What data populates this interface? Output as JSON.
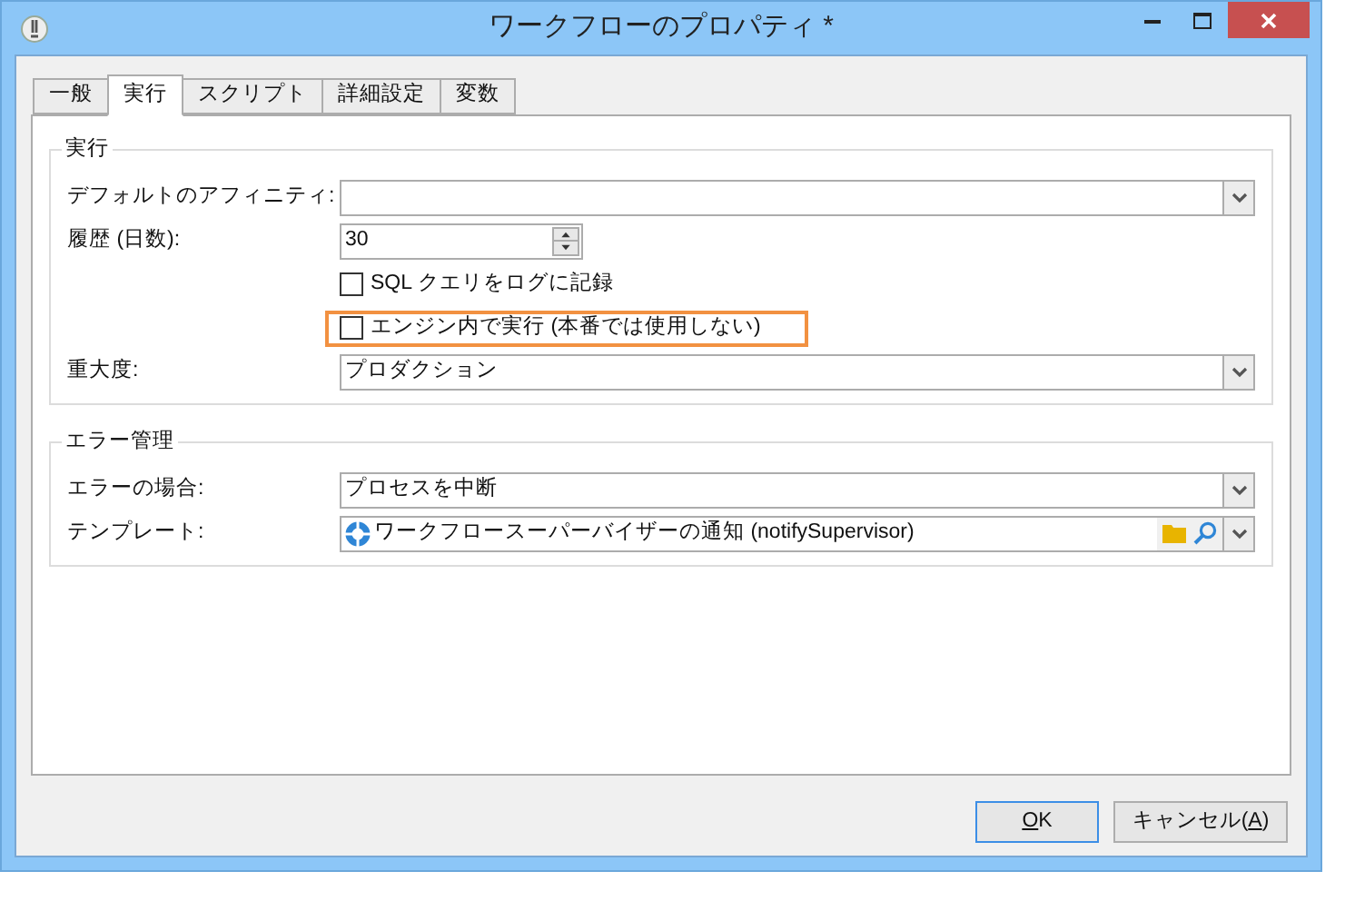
{
  "window": {
    "title": "ワークフローのプロパティ *"
  },
  "tabs": [
    {
      "label": "一般",
      "selected": false
    },
    {
      "label": "実行",
      "selected": true
    },
    {
      "label": "スクリプト",
      "selected": false
    },
    {
      "label": "詳細設定",
      "selected": false
    },
    {
      "label": "変数",
      "selected": false
    }
  ],
  "execution": {
    "title": "実行",
    "rows": [
      {
        "kind": "dropdown",
        "label": "デフォルトのアフィニティ:"
      },
      {
        "kind": "spinner",
        "label": "履歴 (日数):",
        "value": "30"
      },
      {
        "kind": "checkbox",
        "label": "SQL クエリをログに記録",
        "checked": false,
        "highlighted": false
      },
      {
        "kind": "checkbox",
        "label": "エンジン内で実行 (本番では使用しない)",
        "checked": false,
        "highlighted": true
      },
      {
        "kind": "dropdown",
        "label": "重大度:",
        "value": "プロダクション"
      }
    ]
  },
  "error_management": {
    "title": "エラー管理",
    "rows": [
      {
        "kind": "dropdown",
        "label": "エラーの場合:",
        "value": "プロセスを中断"
      },
      {
        "kind": "template",
        "label": "テンプレート:",
        "value": "ワークフロースーパーバイザーの通知 (notifySupervisor)"
      }
    ]
  },
  "buttons": [
    {
      "mnemonic": "O",
      "after": "K",
      "default": true
    },
    {
      "before": "キャンセル(",
      "mnemonic": "A",
      "after": ")",
      "default": false
    }
  ]
}
